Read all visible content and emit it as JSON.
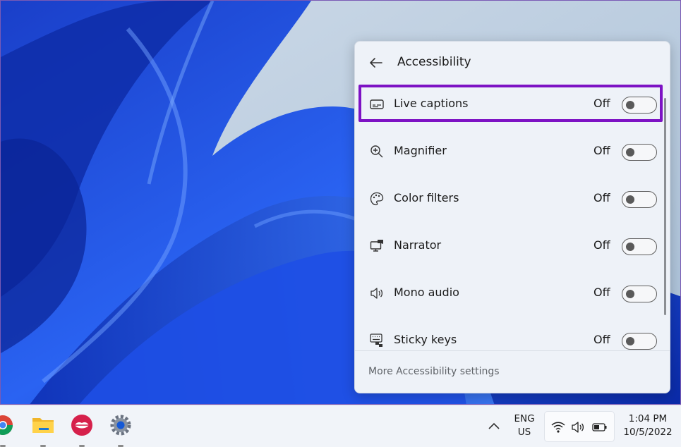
{
  "panel": {
    "title": "Accessibility",
    "footer_link": "More Accessibility settings",
    "items": [
      {
        "label": "Live captions",
        "state": "Off",
        "icon": "captions-icon",
        "on": false
      },
      {
        "label": "Magnifier",
        "state": "Off",
        "icon": "magnifier-icon",
        "on": false
      },
      {
        "label": "Color filters",
        "state": "Off",
        "icon": "palette-icon",
        "on": false
      },
      {
        "label": "Narrator",
        "state": "Off",
        "icon": "narrator-icon",
        "on": false
      },
      {
        "label": "Mono audio",
        "state": "Off",
        "icon": "speaker-icon",
        "on": false
      },
      {
        "label": "Sticky keys",
        "state": "Off",
        "icon": "keyboard-icon",
        "on": false
      }
    ]
  },
  "taskbar": {
    "language": {
      "line1": "ENG",
      "line2": "US"
    },
    "time": "1:04 PM",
    "date": "10/5/2022",
    "apps": [
      "chrome-icon",
      "file-explorer-icon",
      "lips-app-icon",
      "settings-icon"
    ],
    "tray": [
      "chevron-up-icon",
      "wifi-icon",
      "volume-icon",
      "battery-icon"
    ]
  },
  "colors": {
    "highlight": "#7d12c4",
    "wallpaper_blue": "#1f4fe0",
    "panel_bg": "#eef2f8"
  }
}
